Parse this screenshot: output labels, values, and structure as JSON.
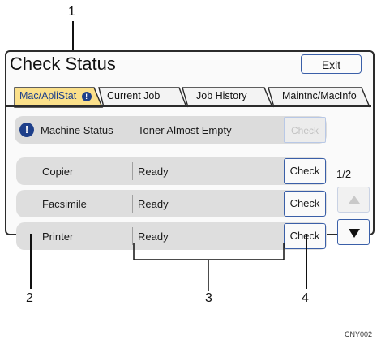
{
  "window": {
    "title": "Check Status",
    "exit_label": "Exit"
  },
  "tabs": [
    {
      "label": "Mac/ApliStat",
      "active": true,
      "has_alert": true
    },
    {
      "label": "Current Job"
    },
    {
      "label": "Job History"
    },
    {
      "label": "Maintnc/MacInfo"
    }
  ],
  "machine_status": {
    "label": "Machine Status",
    "value": "Toner Almost Empty",
    "check_label": "Check",
    "check_enabled": false
  },
  "rows": [
    {
      "label": "Copier",
      "value": "Ready",
      "check_label": "Check"
    },
    {
      "label": "Facsimile",
      "value": "Ready",
      "check_label": "Check"
    },
    {
      "label": "Printer",
      "value": "Ready",
      "check_label": "Check"
    }
  ],
  "pagination": {
    "indicator": "1/2",
    "up_icon": "triangle-up-icon",
    "down_icon": "triangle-down-icon"
  },
  "callouts": [
    "1",
    "2",
    "3",
    "4"
  ],
  "image_code": "CNY002",
  "colors": {
    "accent": "#3a5fa8",
    "alert": "#1e3f8a",
    "active_tab": "#fbe08a",
    "tab_text_active": "#1e3f8a"
  }
}
